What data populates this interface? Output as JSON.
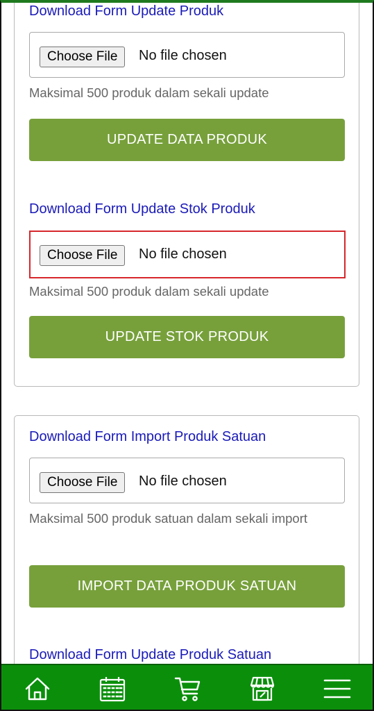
{
  "sections": [
    {
      "link": "Download Form Update Produk",
      "file": {
        "button": "Choose File",
        "status": "No file chosen"
      },
      "hint": "Maksimal 500 produk dalam sekali update",
      "action": "UPDATE DATA PRODUK"
    },
    {
      "link": "Download Form Update Stok Produk",
      "file": {
        "button": "Choose File",
        "status": "No file chosen"
      },
      "hint": "Maksimal 500 produk dalam sekali update",
      "action": "UPDATE STOK PRODUK"
    },
    {
      "link": "Download Form Import Produk Satuan",
      "file": {
        "button": "Choose File",
        "status": "No file chosen"
      },
      "hint": "Maksimal 500 produk satuan dalam sekali import",
      "action": "IMPORT DATA PRODUK SATUAN"
    },
    {
      "link": "Download Form Update Produk Satuan"
    }
  ],
  "nav": {
    "items": [
      "home-icon",
      "calendar-icon",
      "cart-icon",
      "store-icon",
      "menu-icon"
    ],
    "background": "#0b8f0b"
  },
  "colors": {
    "link": "#1a1ab8",
    "button": "#77a03b",
    "highlight": "#d7262b"
  }
}
